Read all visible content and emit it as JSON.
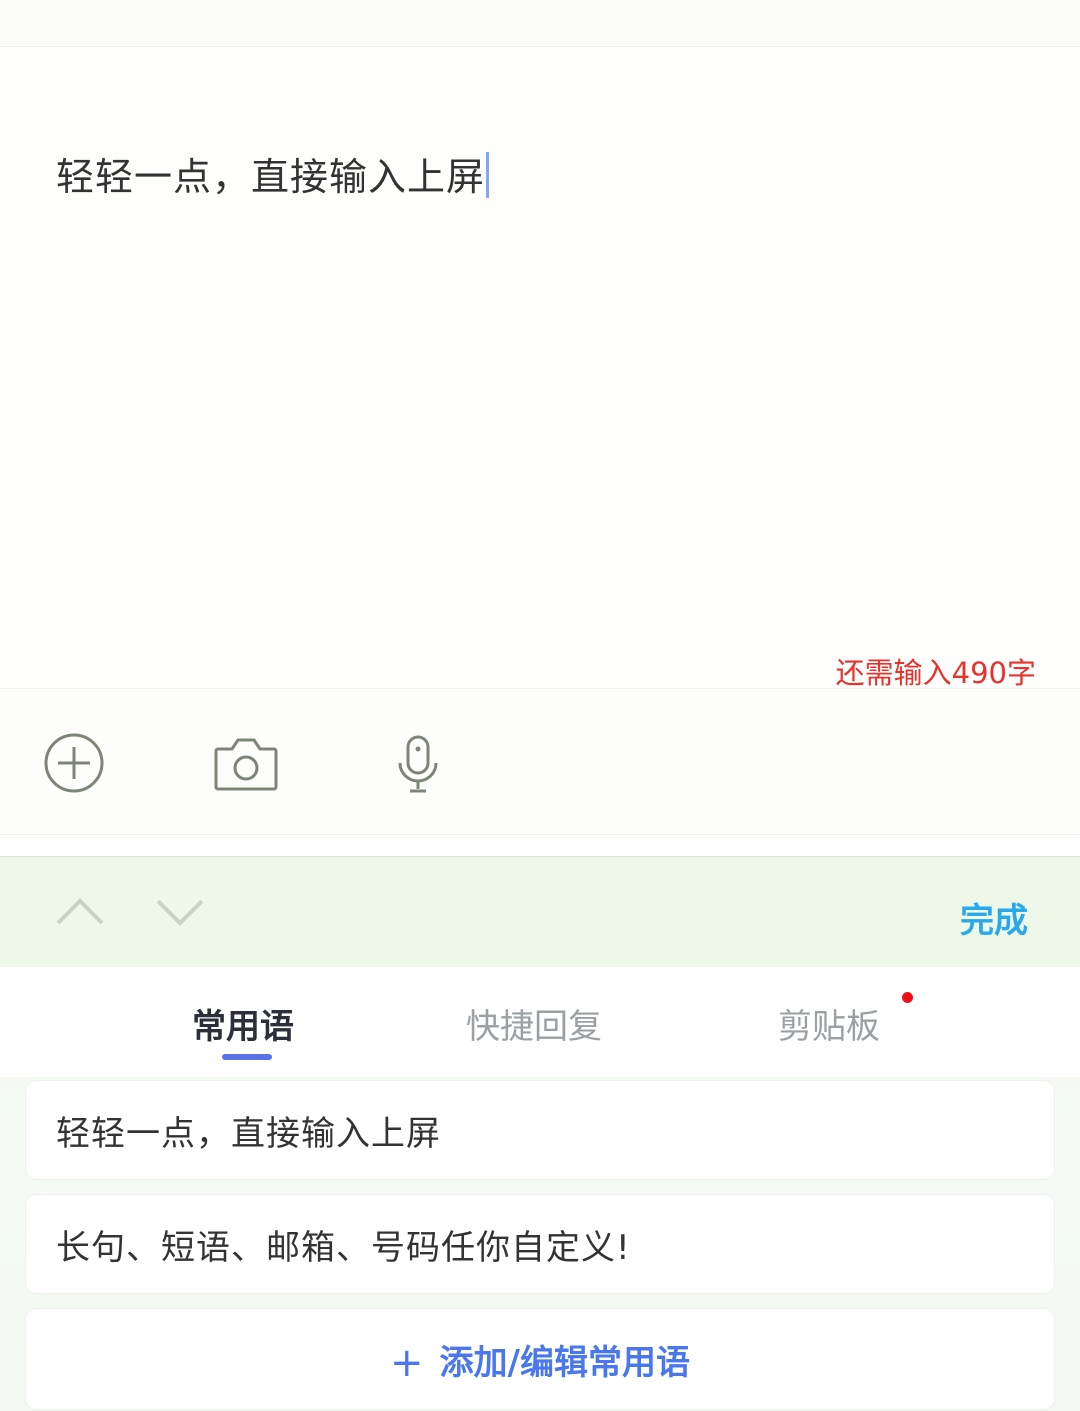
{
  "editor": {
    "text": "轻轻一点，直接输入上屏",
    "remaining": "还需输入490字"
  },
  "toolbar": {
    "icons": [
      "plus-circle-icon",
      "camera-icon",
      "microphone-icon"
    ]
  },
  "keyboard": {
    "done_label": "完成",
    "tabs": [
      {
        "label": "常用语",
        "active": true
      },
      {
        "label": "快捷回复",
        "active": false
      },
      {
        "label": "剪贴板",
        "active": false,
        "has_badge": true
      }
    ],
    "phrases": [
      "轻轻一点，直接输入上屏",
      "长句、短语、邮箱、号码任你自定义!"
    ],
    "add_icon": "+",
    "add_label": "添加/编辑常用语"
  },
  "colors": {
    "accent_blue": "#2aa8ec",
    "tab_underline": "#5a74e6",
    "warning_red": "#e8322e",
    "badge_red": "#f20f1c"
  }
}
